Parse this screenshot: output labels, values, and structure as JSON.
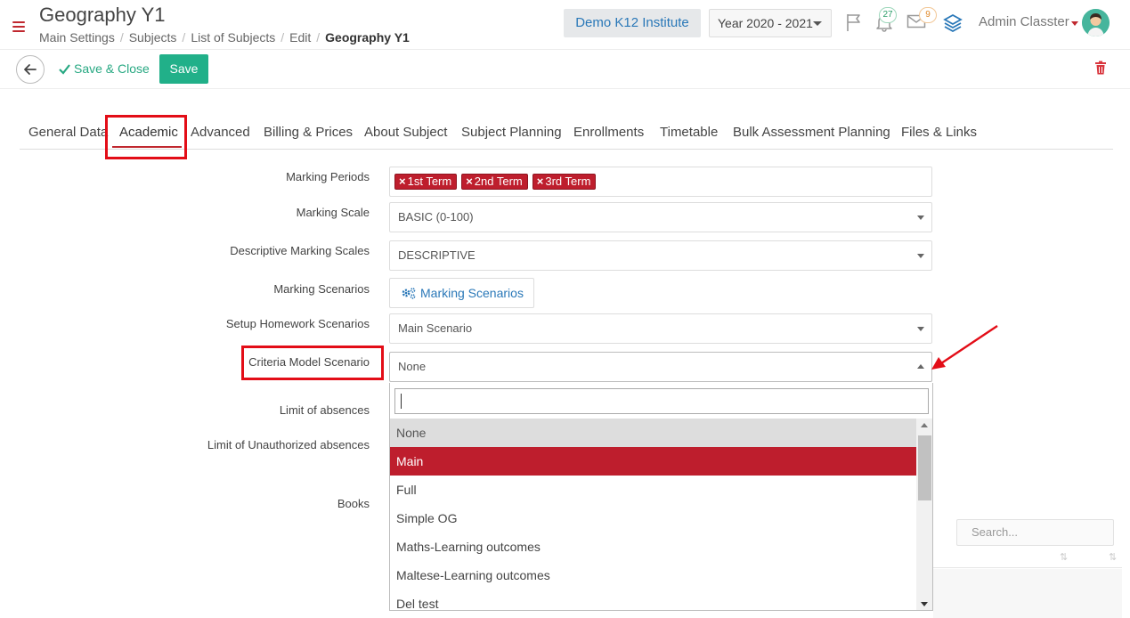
{
  "header": {
    "title": "Geography Y1",
    "breadcrumb": [
      "Main Settings",
      "Subjects",
      "List of Subjects",
      "Edit",
      "Geography Y1"
    ],
    "institute": "Demo K12 Institute",
    "year": "Year 2020 - 2021",
    "notifications_count": "27",
    "messages_count": "9",
    "user_name": "Admin Classter"
  },
  "toolbar": {
    "save_close_label": "Save & Close",
    "save_label": "Save"
  },
  "tabs": [
    "General Data",
    "Academic",
    "Advanced",
    "Billing & Prices",
    "About Subject",
    "Subject Planning",
    "Enrollments",
    "Timetable",
    "Bulk Assessment Planning",
    "Files & Links"
  ],
  "active_tab": "Academic",
  "form": {
    "marking_periods": {
      "label": "Marking Periods",
      "tags": [
        "1st Term",
        "2nd Term",
        "3rd Term"
      ],
      "tag_color": "#be1e2d"
    },
    "marking_scale": {
      "label": "Marking Scale",
      "value": "BASIC (0-100)"
    },
    "descriptive_scales": {
      "label": "Descriptive Marking Scales",
      "value": "DESCRIPTIVE"
    },
    "marking_scenarios": {
      "label": "Marking Scenarios",
      "button": "Marking Scenarios"
    },
    "homework_scenarios": {
      "label": "Setup Homework Scenarios",
      "value": "Main Scenario"
    },
    "criteria_model": {
      "label": "Criteria Model Scenario",
      "value": "None"
    },
    "limit_absences": {
      "label": "Limit of absences"
    },
    "limit_unauthorized": {
      "label": "Limit of Unauthorized absences"
    },
    "books": {
      "label": "Books"
    }
  },
  "dropdown": {
    "search_value": "",
    "options": [
      "None",
      "Main",
      "Full",
      "Simple OG",
      "Maths-Learning outcomes",
      "Maltese-Learning outcomes",
      "Del test"
    ],
    "selected": "None",
    "highlighted": "Main",
    "highlight_color": "#be1e2d"
  },
  "books_table": {
    "search_placeholder": "Search..."
  },
  "colors": {
    "accent_red": "#c0282f",
    "save_green": "#21b089",
    "link_blue": "#2a78b8",
    "annotation_red": "#e30d17"
  },
  "icons": [
    "menu-icon",
    "flag-icon",
    "bell-icon",
    "envelope-icon",
    "stack-icon",
    "back-arrow-icon",
    "check-icon",
    "trash-icon",
    "gears-icon"
  ]
}
